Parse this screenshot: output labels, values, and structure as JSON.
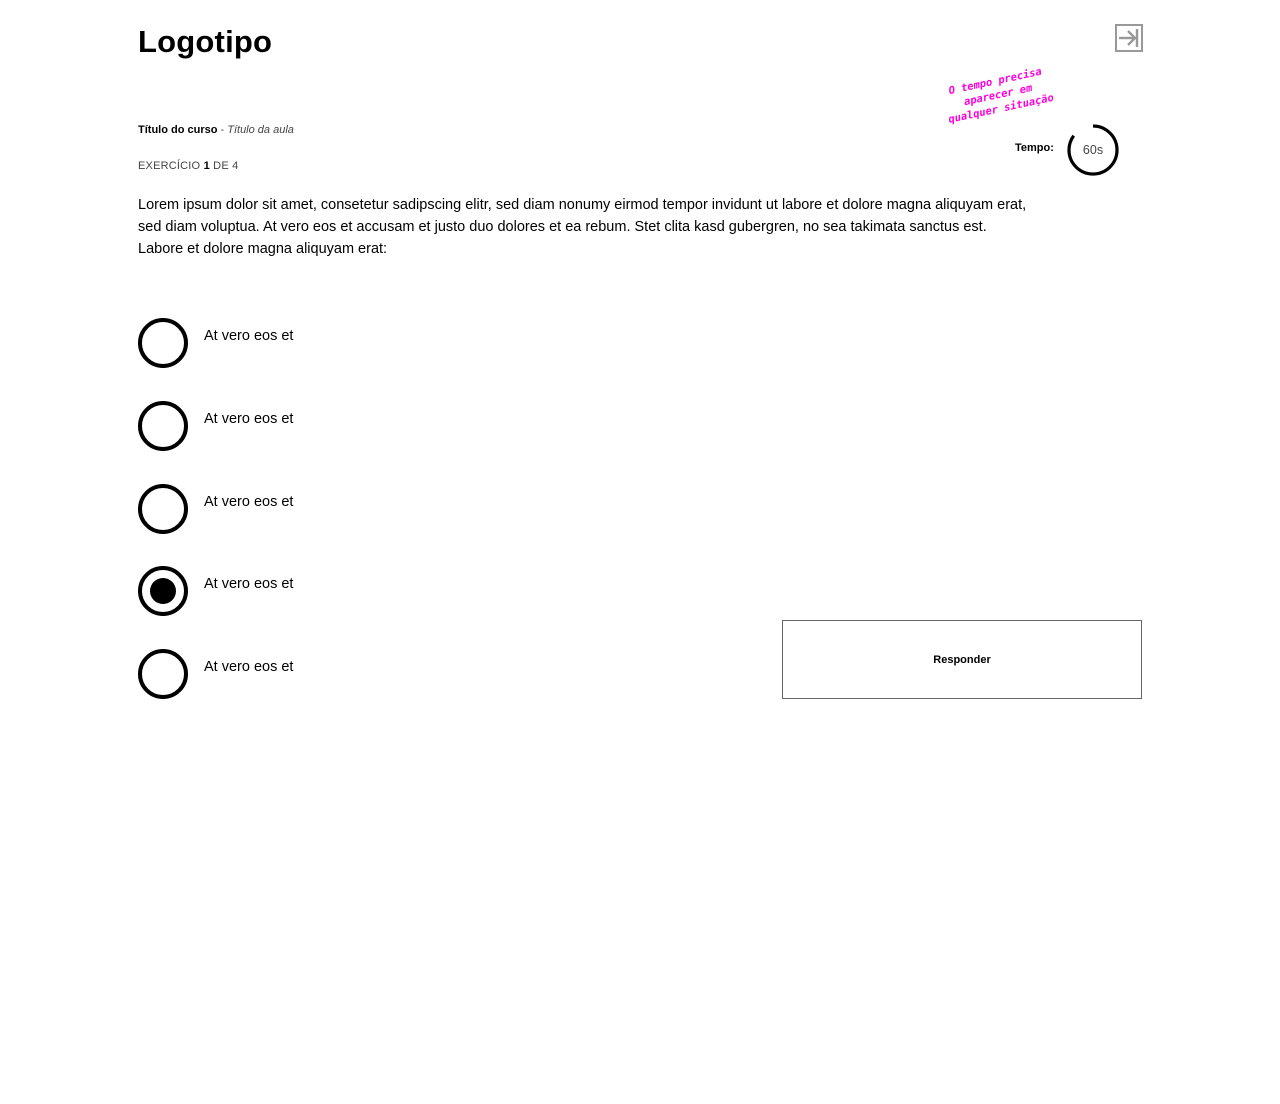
{
  "header": {
    "logo": "Logotipo",
    "exit_icon": "exit-icon"
  },
  "annotation": {
    "lines": [
      "O tempo precisa",
      "aparecer em",
      "qualquer situação"
    ],
    "color": "#ff00dd"
  },
  "course": {
    "course_title": "Título do curso",
    "separator": " - ",
    "lesson_title": "Título da aula"
  },
  "exercise": {
    "prefix": "EXERCÍCIO",
    "current": "1",
    "middle": "DE",
    "total": "4"
  },
  "timer": {
    "label": "Tempo:",
    "value": "60s",
    "progress": 0.85
  },
  "question": {
    "lines": [
      "Lorem ipsum dolor sit amet, consetetur sadipscing elitr, sed diam nonumy eirmod tempor invidunt ut labore et dolore magna aliquyam erat,",
      "sed diam voluptua. At vero eos et accusam et justo duo dolores et ea rebum. Stet clita kasd gubergren, no sea takimata sanctus est.",
      "Labore et dolore magna aliquyam erat:"
    ]
  },
  "options": [
    {
      "label": "At vero eos et",
      "selected": false
    },
    {
      "label": "At vero eos et",
      "selected": false
    },
    {
      "label": "At vero eos et",
      "selected": false
    },
    {
      "label": "At vero eos et",
      "selected": true
    },
    {
      "label": "At vero eos et",
      "selected": false
    }
  ],
  "submit": {
    "label": "Responder"
  }
}
